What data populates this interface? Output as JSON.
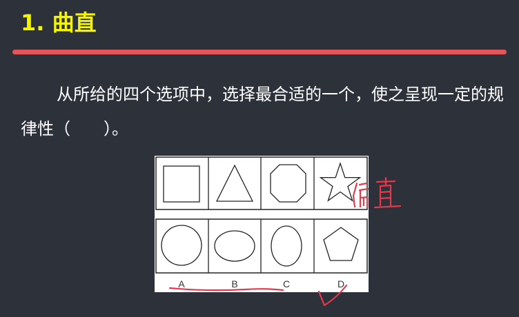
{
  "slide": {
    "title": "1. 曲直",
    "question": "从所给的四个选项中，选择最合适的一个，使之呈现一定的规律性（　　）。"
  },
  "options": [
    "A",
    "B",
    "C",
    "D"
  ],
  "annotation": {
    "handwritten_note": "偏直",
    "answer": "D"
  },
  "colors": {
    "background": "#2c313a",
    "title": "#f5f500",
    "title_bar": "#e0565a",
    "ink": "#e8384a"
  }
}
